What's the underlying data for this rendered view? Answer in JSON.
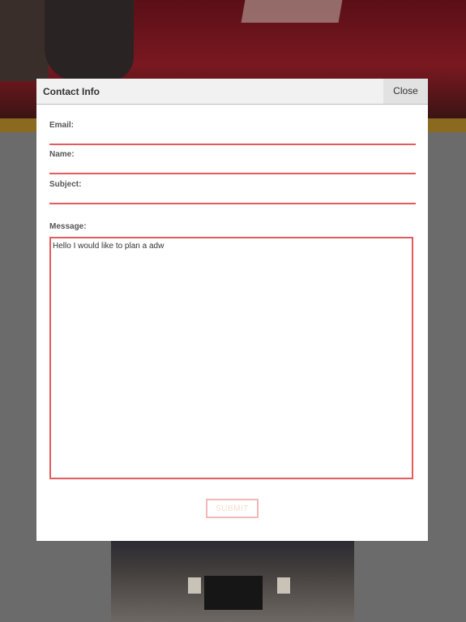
{
  "modal": {
    "title": "Contact Info",
    "close_label": "Close"
  },
  "form": {
    "email_label": "Email:",
    "email_value": "",
    "name_label": "Name:",
    "name_value": "",
    "subject_label": "Subject:",
    "subject_value": "",
    "message_label": "Message:",
    "message_value": "Hello I would like to plan a adw",
    "submit_label": "SUBMIT"
  },
  "colors": {
    "accent_red": "#e45b5e",
    "submit_border": "#f2b8b9",
    "overlay_gray": "#6b6b6b",
    "gold_band": "#8a6a1e"
  }
}
